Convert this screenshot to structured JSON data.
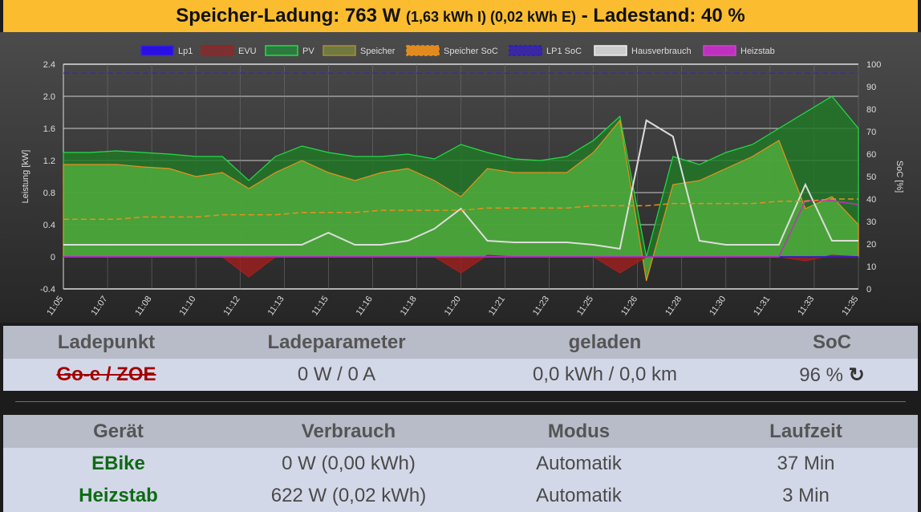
{
  "header": {
    "prefix": "Speicher-Ladung: 763 W",
    "detail": "(1,63 kWh I) (0,02 kWh E)",
    "suffix": "- Ladestand: 40 %"
  },
  "chart_data": {
    "type": "area",
    "ylabel": "Leistung [kW]",
    "y2label": "SoC [%]",
    "ylim": [
      -0.4,
      2.4
    ],
    "y2lim": [
      0,
      100
    ],
    "yticks": [
      "2.4",
      "2.0",
      "1.6",
      "1.2",
      "0.8",
      "0.4",
      "0",
      "-0.4"
    ],
    "y2ticks": [
      "100",
      "90",
      "80",
      "70",
      "60",
      "50",
      "40",
      "30",
      "20",
      "10",
      "0"
    ],
    "xticks": [
      "11:05",
      "11:07",
      "11:08",
      "11:10",
      "11:12",
      "11:13",
      "11:15",
      "11:16",
      "11:18",
      "11:20",
      "11:21",
      "11:23",
      "11:25",
      "11:26",
      "11:28",
      "11:30",
      "11:31",
      "11:33",
      "11:35"
    ],
    "legend": [
      "Lp1",
      "EVU",
      "PV",
      "Speicher",
      "Speicher SoC",
      "LP1 SoC",
      "Hausverbrauch",
      "Heizstab"
    ],
    "legend_position": "top",
    "colors": {
      "lp1": "#2a10e0",
      "evu": "#a02020",
      "pv": "#22dd44",
      "speicher": "#b08a30",
      "speicher_soc": "#e8901e",
      "lp1_soc": "#3a28b8",
      "haus": "#dddddd",
      "heizstab": "#c030c0"
    },
    "series": {
      "pv": [
        1.3,
        1.3,
        1.32,
        1.3,
        1.28,
        1.25,
        1.25,
        0.95,
        1.25,
        1.38,
        1.3,
        1.25,
        1.25,
        1.28,
        1.22,
        1.4,
        1.3,
        1.22,
        1.2,
        1.25,
        1.45,
        1.75,
        0.0,
        1.25,
        1.15,
        1.3,
        1.4,
        1.6,
        1.8,
        2.0,
        1.6
      ],
      "speicher": [
        1.15,
        1.15,
        1.15,
        1.12,
        1.1,
        1.0,
        1.05,
        0.85,
        1.05,
        1.2,
        1.05,
        0.95,
        1.05,
        1.1,
        0.95,
        0.75,
        1.1,
        1.05,
        1.05,
        1.05,
        1.3,
        1.7,
        -0.3,
        0.9,
        0.95,
        1.1,
        1.25,
        1.45,
        0.6,
        0.75,
        0.4
      ],
      "hausverbrauch": [
        0.15,
        0.15,
        0.15,
        0.15,
        0.15,
        0.15,
        0.15,
        0.15,
        0.15,
        0.15,
        0.3,
        0.15,
        0.15,
        0.2,
        0.35,
        0.6,
        0.2,
        0.18,
        0.18,
        0.18,
        0.15,
        0.1,
        1.7,
        1.5,
        0.2,
        0.15,
        0.15,
        0.15,
        0.9,
        0.2,
        0.2
      ],
      "evu": [
        0,
        0,
        0,
        0,
        0,
        0,
        0,
        -0.25,
        0,
        0,
        0,
        0,
        0,
        0,
        0,
        -0.2,
        0.02,
        0,
        0,
        0,
        0,
        -0.2,
        0,
        0,
        0,
        0,
        0,
        0,
        -0.05,
        0.02,
        0
      ],
      "heizstab": [
        0,
        0,
        0,
        0,
        0,
        0,
        0,
        0,
        0,
        0,
        0,
        0,
        0,
        0,
        0,
        0,
        0,
        0,
        0,
        0,
        0,
        0,
        0,
        0,
        0,
        0,
        0,
        0,
        0.7,
        0.7,
        0.65
      ],
      "lp1": [
        0,
        0,
        0,
        0,
        0,
        0,
        0,
        0,
        0,
        0,
        0,
        0,
        0,
        0,
        0,
        0,
        0,
        0,
        0,
        0,
        0,
        0,
        0,
        0,
        0,
        0,
        0,
        0,
        0,
        0,
        0
      ],
      "speicher_soc": [
        31,
        31,
        31,
        32,
        32,
        32,
        33,
        33,
        33,
        34,
        34,
        34,
        35,
        35,
        35,
        35,
        36,
        36,
        36,
        36,
        37,
        37,
        37,
        38,
        38,
        38,
        38,
        39,
        39,
        40,
        40
      ],
      "lp1_soc": [
        96,
        96,
        96,
        96,
        96,
        96,
        96,
        96,
        96,
        96,
        96,
        96,
        96,
        96,
        96,
        96,
        96,
        96,
        96,
        96,
        96,
        96,
        96,
        96,
        96,
        96,
        96,
        96,
        96,
        96,
        96
      ]
    }
  },
  "ladepunkt_table": {
    "headers": [
      "Ladepunkt",
      "Ladeparameter",
      "geladen",
      "SoC"
    ],
    "row": {
      "name": "Go-e / ZOE",
      "params": "0 W / 0 A",
      "geladen": "0,0 kWh / 0,0 km",
      "soc": "96 %",
      "refresh_icon": "refresh-icon"
    }
  },
  "geraete_table": {
    "headers": [
      "Gerät",
      "Verbrauch",
      "Modus",
      "Laufzeit"
    ],
    "rows": [
      {
        "name": "EBike",
        "verbrauch": "0 W (0,00 kWh)",
        "modus": "Automatik",
        "laufzeit": "37 Min"
      },
      {
        "name": "Heizstab",
        "verbrauch": "622 W (0,02 kWh)",
        "modus": "Automatik",
        "laufzeit": "3 Min"
      }
    ]
  }
}
